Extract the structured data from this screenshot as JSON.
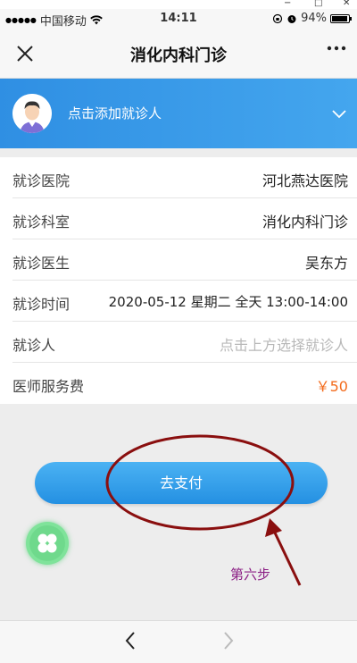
{
  "window_controls": {
    "minimize": "−",
    "maximize": "□",
    "close": "✕"
  },
  "status_bar": {
    "carrier": "中国移动",
    "time": "14:11",
    "battery": "94%"
  },
  "nav": {
    "title": "消化内科门诊",
    "close_icon": "close-icon",
    "more_icon": "more-icon"
  },
  "patient_banner": {
    "prompt": "点击添加就诊人"
  },
  "info": {
    "rows": [
      {
        "label": "就诊医院",
        "value": "河北燕达医院"
      },
      {
        "label": "就诊科室",
        "value": "消化内科门诊"
      },
      {
        "label": "就诊医生",
        "value": "吴东方"
      },
      {
        "label": "就诊时间",
        "value": "2020-05-12 星期二 全天 13:00-14:00"
      },
      {
        "label": "就诊人",
        "value": "点击上方选择就诊人"
      },
      {
        "label": "医师服务费",
        "value": "￥50"
      }
    ]
  },
  "pay_button": {
    "label": "去支付"
  },
  "annotation": {
    "step": "第六步"
  },
  "colors": {
    "accent": "#2f8fe3",
    "price": "#f36b1c",
    "annotation": "#8b1e84",
    "annotation_circle": "#8a0f0f"
  }
}
